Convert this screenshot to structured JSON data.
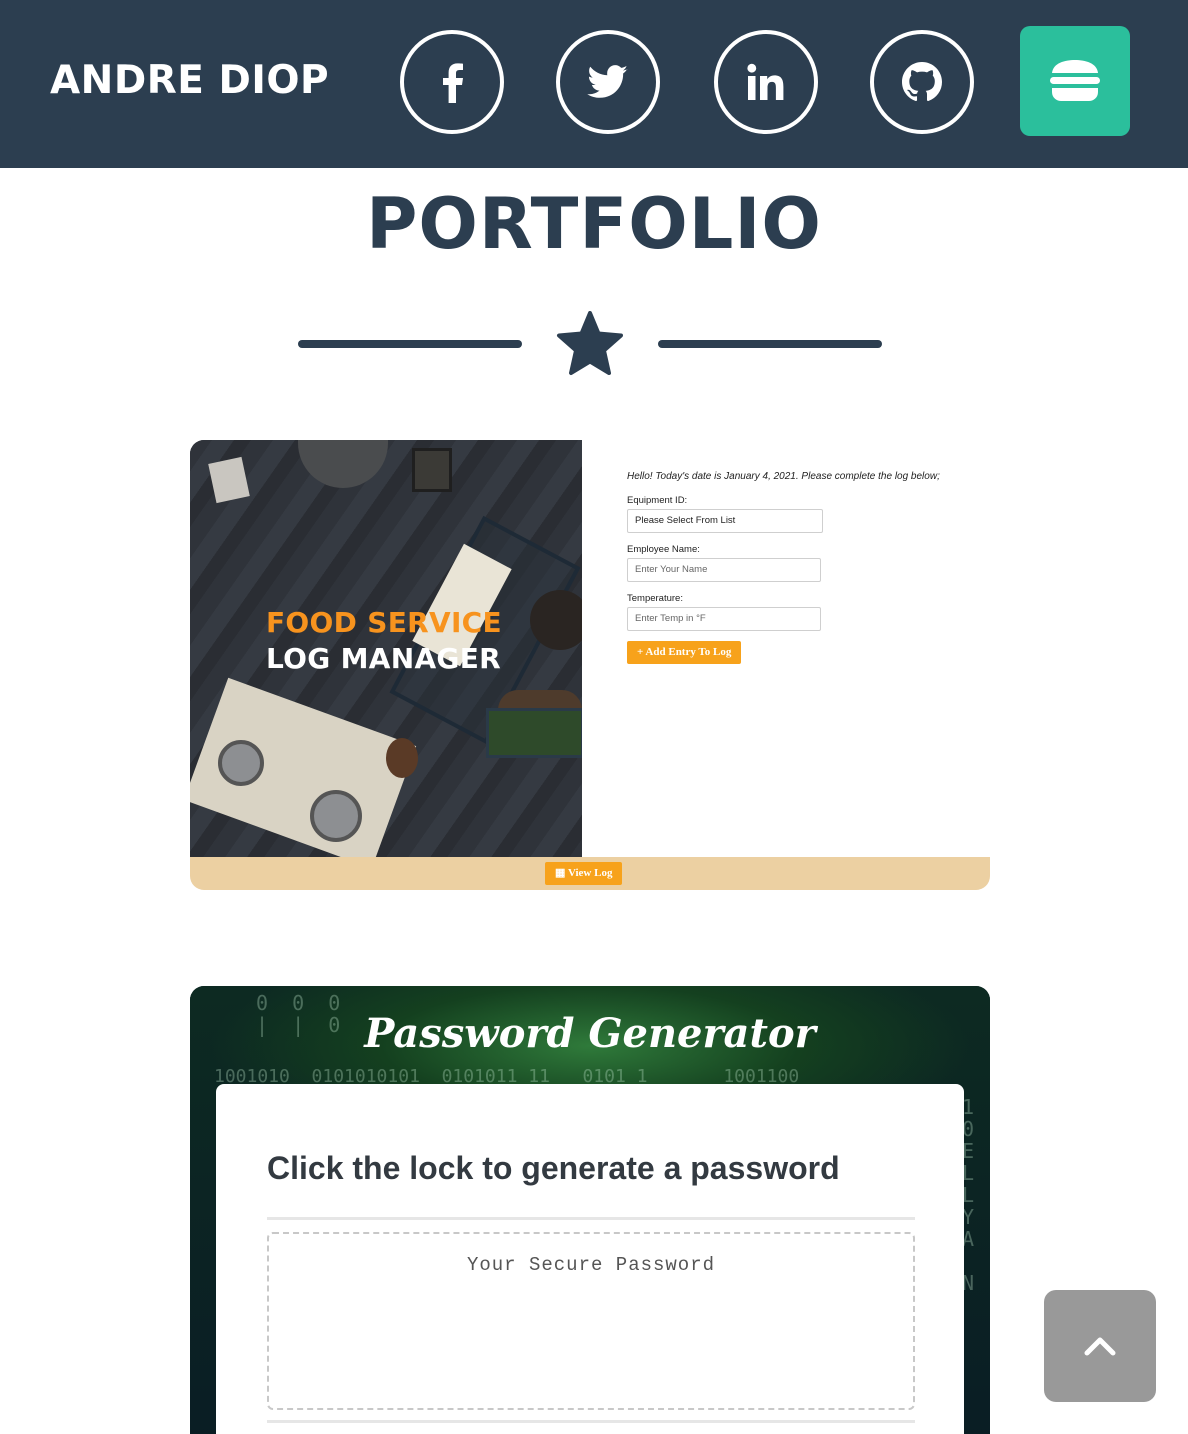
{
  "navbar": {
    "brand": "ANDRE DIOP",
    "social": [
      {
        "icon": "facebook-icon"
      },
      {
        "icon": "twitter-icon"
      },
      {
        "icon": "linkedin-icon"
      },
      {
        "icon": "github-icon"
      }
    ],
    "menu_icon": "hamburger-icon",
    "colors": {
      "background": "#2c3e50",
      "menu_button": "#2bbf9c"
    }
  },
  "section": {
    "title": "PORTFOLIO",
    "divider_icon": "star-icon"
  },
  "projects": [
    {
      "title_line1": "FOOD SERVICE",
      "title_line2": "LOG MANAGER",
      "greeting": "Hello! Today's date is January 4, 2021. Please complete the log below;",
      "fields": [
        {
          "label": "Equipment ID:",
          "value": "Please Select From List"
        },
        {
          "label": "Employee Name:",
          "placeholder": "Enter Your Name"
        },
        {
          "label": "Temperature:",
          "placeholder": "Enter Temp in °F"
        }
      ],
      "add_button": "Add Entry To Log",
      "view_button": "View Log",
      "accent": "#f7a21b"
    },
    {
      "title": "Password Generator",
      "heading": "Click the lock to generate a password",
      "password_placeholder": "Your Secure Password"
    }
  ],
  "back_to_top_icon": "chevron-up-icon"
}
